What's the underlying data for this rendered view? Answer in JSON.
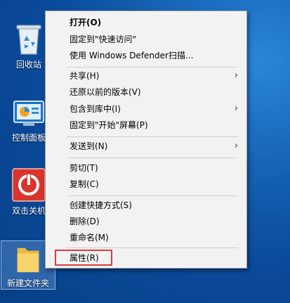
{
  "desktop": {
    "icons": [
      {
        "label": "回收站",
        "icon": "recycle-bin-icon"
      },
      {
        "label": "控制面板",
        "icon": "control-panel-icon"
      },
      {
        "label": "双击关机",
        "icon": "power-icon"
      },
      {
        "label": "新建文件夹",
        "icon": "folder-icon"
      }
    ]
  },
  "menu": {
    "items": [
      {
        "label": "打开(O)"
      },
      {
        "label": "固定到\"快速访问\""
      },
      {
        "label": "使用 Windows Defender扫描..."
      },
      {
        "label": "共享(H)"
      },
      {
        "label": "还原以前的版本(V)"
      },
      {
        "label": "包含到库中(I)"
      },
      {
        "label": "固定到\"开始\"屏幕(P)"
      },
      {
        "label": "发送到(N)"
      },
      {
        "label": "剪切(T)"
      },
      {
        "label": "复制(C)"
      },
      {
        "label": "创建快捷方式(S)"
      },
      {
        "label": "删除(D)"
      },
      {
        "label": "重命名(M)"
      },
      {
        "label": "属性(R)"
      }
    ],
    "submenu_arrow": "›"
  },
  "colors": {
    "highlight_border": "#e0393e",
    "menu_background": "#f2f2f2"
  }
}
